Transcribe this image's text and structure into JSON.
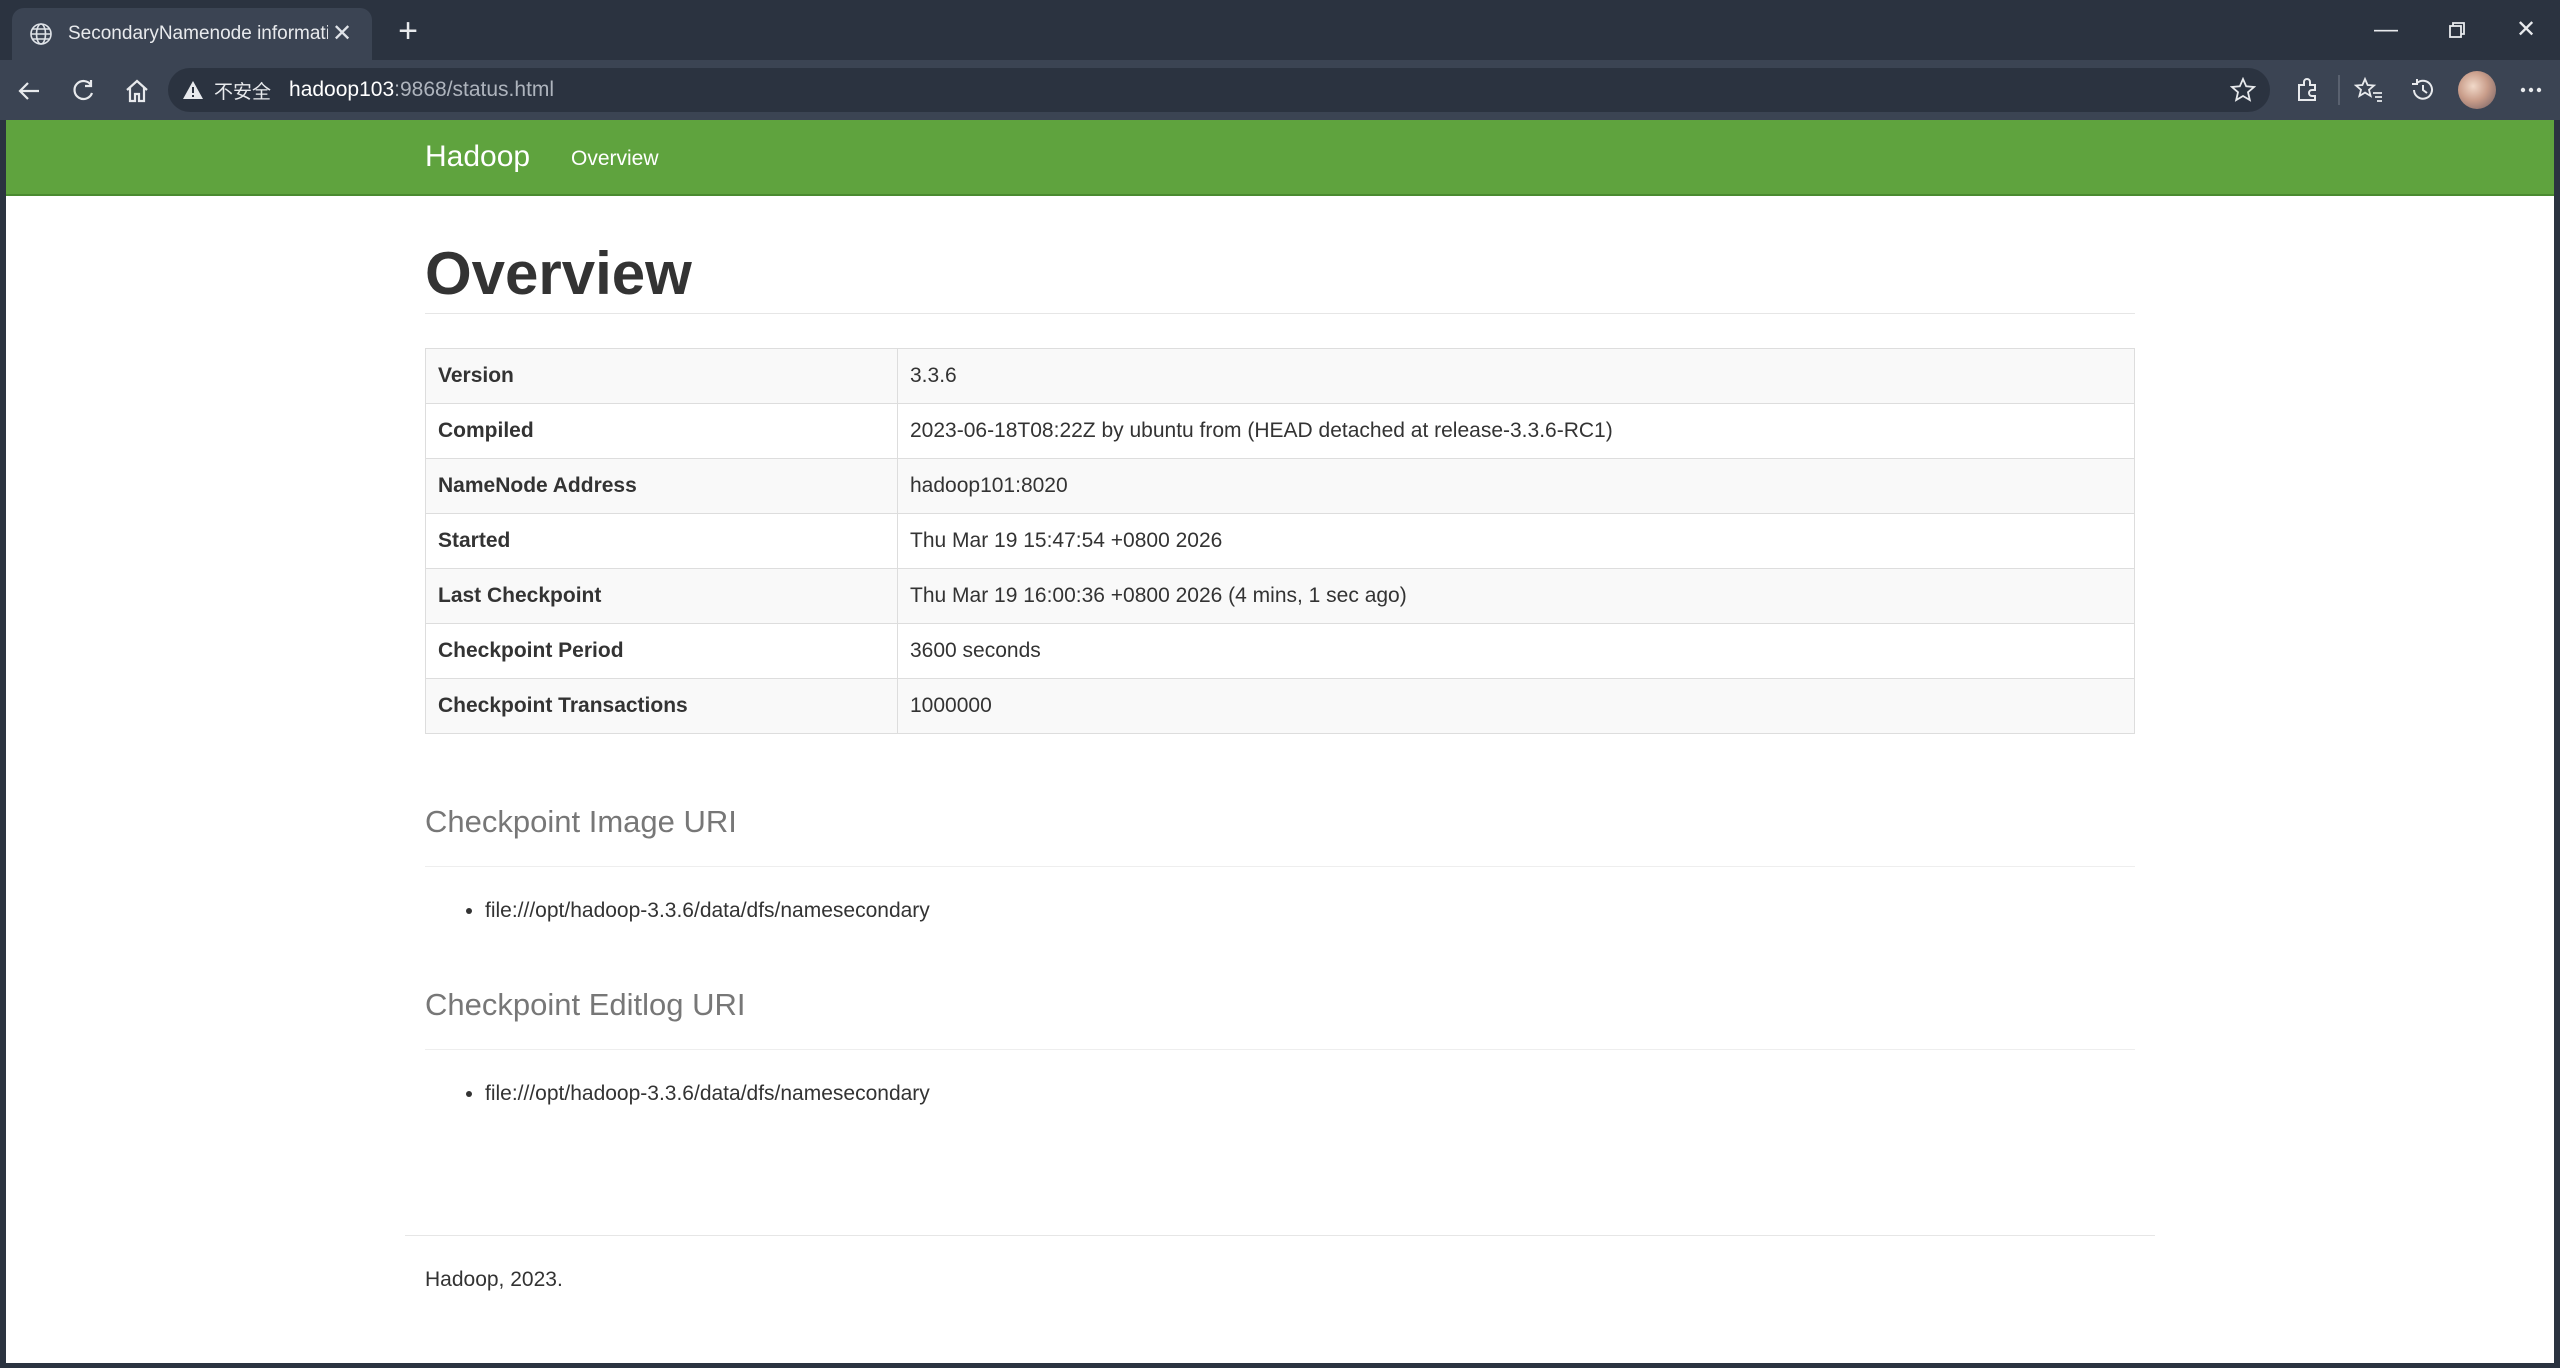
{
  "browser": {
    "tab_title": "SecondaryNamenode information",
    "security_label": "不安全",
    "url_host": "hadoop103",
    "url_rest": ":9868/status.html"
  },
  "nav": {
    "brand": "Hadoop",
    "overview_link": "Overview"
  },
  "page": {
    "title": "Overview",
    "rows": [
      {
        "key": "Version",
        "value": "3.3.6"
      },
      {
        "key": "Compiled",
        "value": "2023-06-18T08:22Z by ubuntu from (HEAD detached at release-3.3.6-RC1)"
      },
      {
        "key": "NameNode Address",
        "value": "hadoop101:8020"
      },
      {
        "key": "Started",
        "value": "Thu Mar 19 15:47:54 +0800 2026"
      },
      {
        "key": "Last Checkpoint",
        "value": "Thu Mar 19 16:00:36 +0800 2026 (4 mins, 1 sec ago)"
      },
      {
        "key": "Checkpoint Period",
        "value": "3600 seconds"
      },
      {
        "key": "Checkpoint Transactions",
        "value": "1000000"
      }
    ],
    "image_uri_title": "Checkpoint Image URI",
    "image_uris": [
      "file:///opt/hadoop-3.3.6/data/dfs/namesecondary"
    ],
    "editlog_uri_title": "Checkpoint Editlog URI",
    "editlog_uris": [
      "file:///opt/hadoop-3.3.6/data/dfs/namesecondary"
    ],
    "footer": "Hadoop, 2023."
  }
}
